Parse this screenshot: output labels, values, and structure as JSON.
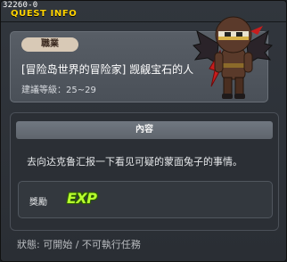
{
  "window": {
    "quest_id": "32260-0",
    "title": "QUEST INFO"
  },
  "quest": {
    "job_tag": "職業",
    "name": "[冒险岛世界的冒险家] 觊觎宝石的人",
    "recommended_level": "建議等級：25~29",
    "npc_icon": "npc-ninja-with-bat-wings"
  },
  "content": {
    "header": "內容",
    "description": "去向达克鲁汇报一下看见可疑的蒙面兔子的事情。",
    "reward_label": "獎勵",
    "reward_badge": "EXP",
    "reward_color": "#b6ff2e"
  },
  "status": {
    "text": "狀態: 可開始 / 不可執行任務"
  },
  "colors": {
    "title": "#ffd400",
    "background": "#2f343a",
    "job_tag_bg": "#d8c9b6"
  }
}
